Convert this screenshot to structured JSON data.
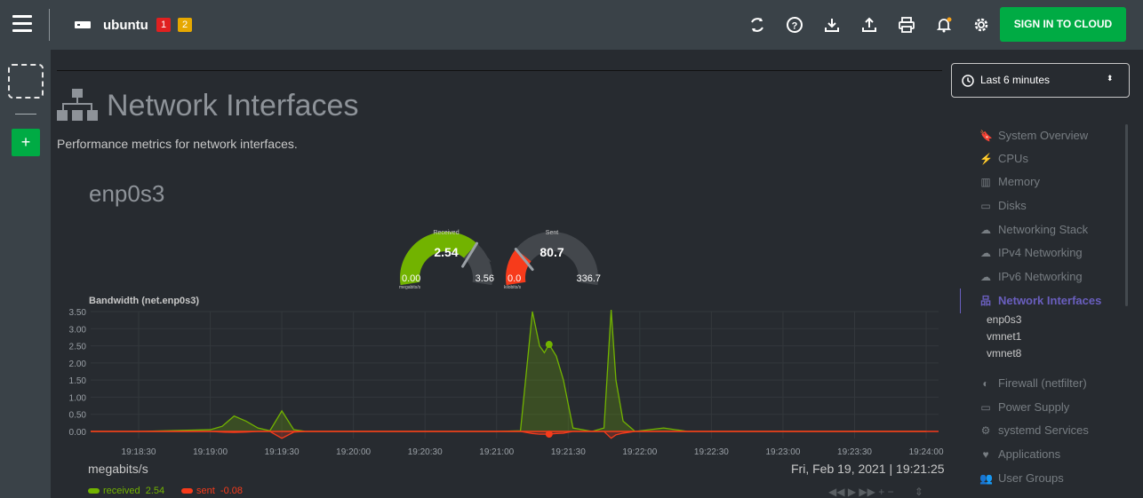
{
  "topbar": {
    "host_name": "ubuntu",
    "badge_red": "1",
    "badge_yellow": "2",
    "signin_label": "SIGN IN TO CLOUD"
  },
  "section": {
    "title": "Network Interfaces",
    "description": "Performance metrics for network interfaces."
  },
  "interface": {
    "name": "enp0s3"
  },
  "gauges": {
    "received": {
      "title": "Received",
      "value": "2.54",
      "min": "0.00",
      "max": "3.56",
      "unit": "megabits/s",
      "fraction": 0.71,
      "color": "#72b300"
    },
    "sent": {
      "title": "Sent",
      "value": "80.7",
      "min": "0.0",
      "max": "336.7",
      "unit": "kilobits/s",
      "fraction": 0.24,
      "color": "#f73b1b"
    }
  },
  "chart": {
    "title": "Bandwidth (net.enp0s3)",
    "units": "megabits/s",
    "datetime": "Fri, Feb 19, 2021 | 19:21:25",
    "legend": {
      "received_label": "received",
      "received_value": "2.54",
      "sent_label": "sent",
      "sent_value": "-0.08"
    }
  },
  "chart_data": {
    "type": "area",
    "title": "Bandwidth (net.enp0s3)",
    "ylabel": "megabits/s",
    "ylim": [
      -0.2,
      3.5
    ],
    "yticks": [
      "3.50",
      "3.00",
      "2.50",
      "2.00",
      "1.50",
      "1.00",
      "0.50",
      "0.00"
    ],
    "xticks": [
      "19:18:30",
      "19:19:00",
      "19:19:30",
      "19:20:00",
      "19:20:30",
      "19:21:00",
      "19:21:30",
      "19:22:00",
      "19:22:30",
      "19:23:00",
      "19:23:30",
      "19:24:00"
    ],
    "x": [
      "19:18:00",
      "19:18:30",
      "19:19:00",
      "19:19:05",
      "19:19:10",
      "19:19:15",
      "19:19:20",
      "19:19:25",
      "19:19:30",
      "19:19:35",
      "19:19:40",
      "19:20:00",
      "19:20:30",
      "19:21:00",
      "19:21:10",
      "19:21:15",
      "19:21:18",
      "19:21:20",
      "19:21:22",
      "19:21:25",
      "19:21:28",
      "19:21:32",
      "19:21:40",
      "19:21:45",
      "19:21:48",
      "19:21:50",
      "19:21:53",
      "19:21:58",
      "19:22:10",
      "19:22:20",
      "19:22:30",
      "19:23:00",
      "19:23:30",
      "19:24:00"
    ],
    "series": [
      {
        "name": "received",
        "color": "#72b300",
        "values": [
          0,
          0,
          0.05,
          0.15,
          0.45,
          0.3,
          0.1,
          0.02,
          0.6,
          0.05,
          0,
          0,
          0,
          0,
          0.02,
          3.5,
          2.5,
          2.3,
          2.54,
          2.2,
          1.5,
          0.1,
          0,
          0.1,
          3.55,
          1.5,
          0.3,
          0,
          0.1,
          0,
          0,
          0,
          0,
          0
        ]
      },
      {
        "name": "sent",
        "color": "#f73b1b",
        "values": [
          0,
          0,
          0,
          -0.02,
          -0.03,
          -0.02,
          0,
          0,
          -0.2,
          -0.02,
          0,
          0,
          0,
          0,
          0,
          -0.06,
          -0.08,
          -0.08,
          -0.08,
          -0.06,
          -0.05,
          0,
          0,
          0,
          -0.2,
          -0.1,
          -0.05,
          0,
          0,
          0,
          0,
          0,
          0,
          0
        ]
      }
    ]
  },
  "time_picker": {
    "label": "Last 6 minutes"
  },
  "side_nav": {
    "items": [
      {
        "label": "System Overview",
        "icon": "bookmark-icon"
      },
      {
        "label": "CPUs",
        "icon": "bolt-icon"
      },
      {
        "label": "Memory",
        "icon": "memory-icon"
      },
      {
        "label": "Disks",
        "icon": "hdd-icon"
      },
      {
        "label": "Networking Stack",
        "icon": "cloud-icon"
      },
      {
        "label": "IPv4 Networking",
        "icon": "cloud-icon"
      },
      {
        "label": "IPv6 Networking",
        "icon": "cloud-icon"
      },
      {
        "label": "Network Interfaces",
        "icon": "sitemap-icon"
      },
      {
        "label": "Firewall (netfilter)",
        "icon": "shield-icon"
      },
      {
        "label": "Power Supply",
        "icon": "battery-icon"
      },
      {
        "label": "systemd Services",
        "icon": "cogs-icon"
      },
      {
        "label": "Applications",
        "icon": "heartbeat-icon"
      },
      {
        "label": "User Groups",
        "icon": "users-icon"
      }
    ],
    "sub_items": [
      "enp0s3",
      "vmnet1",
      "vmnet8"
    ]
  }
}
